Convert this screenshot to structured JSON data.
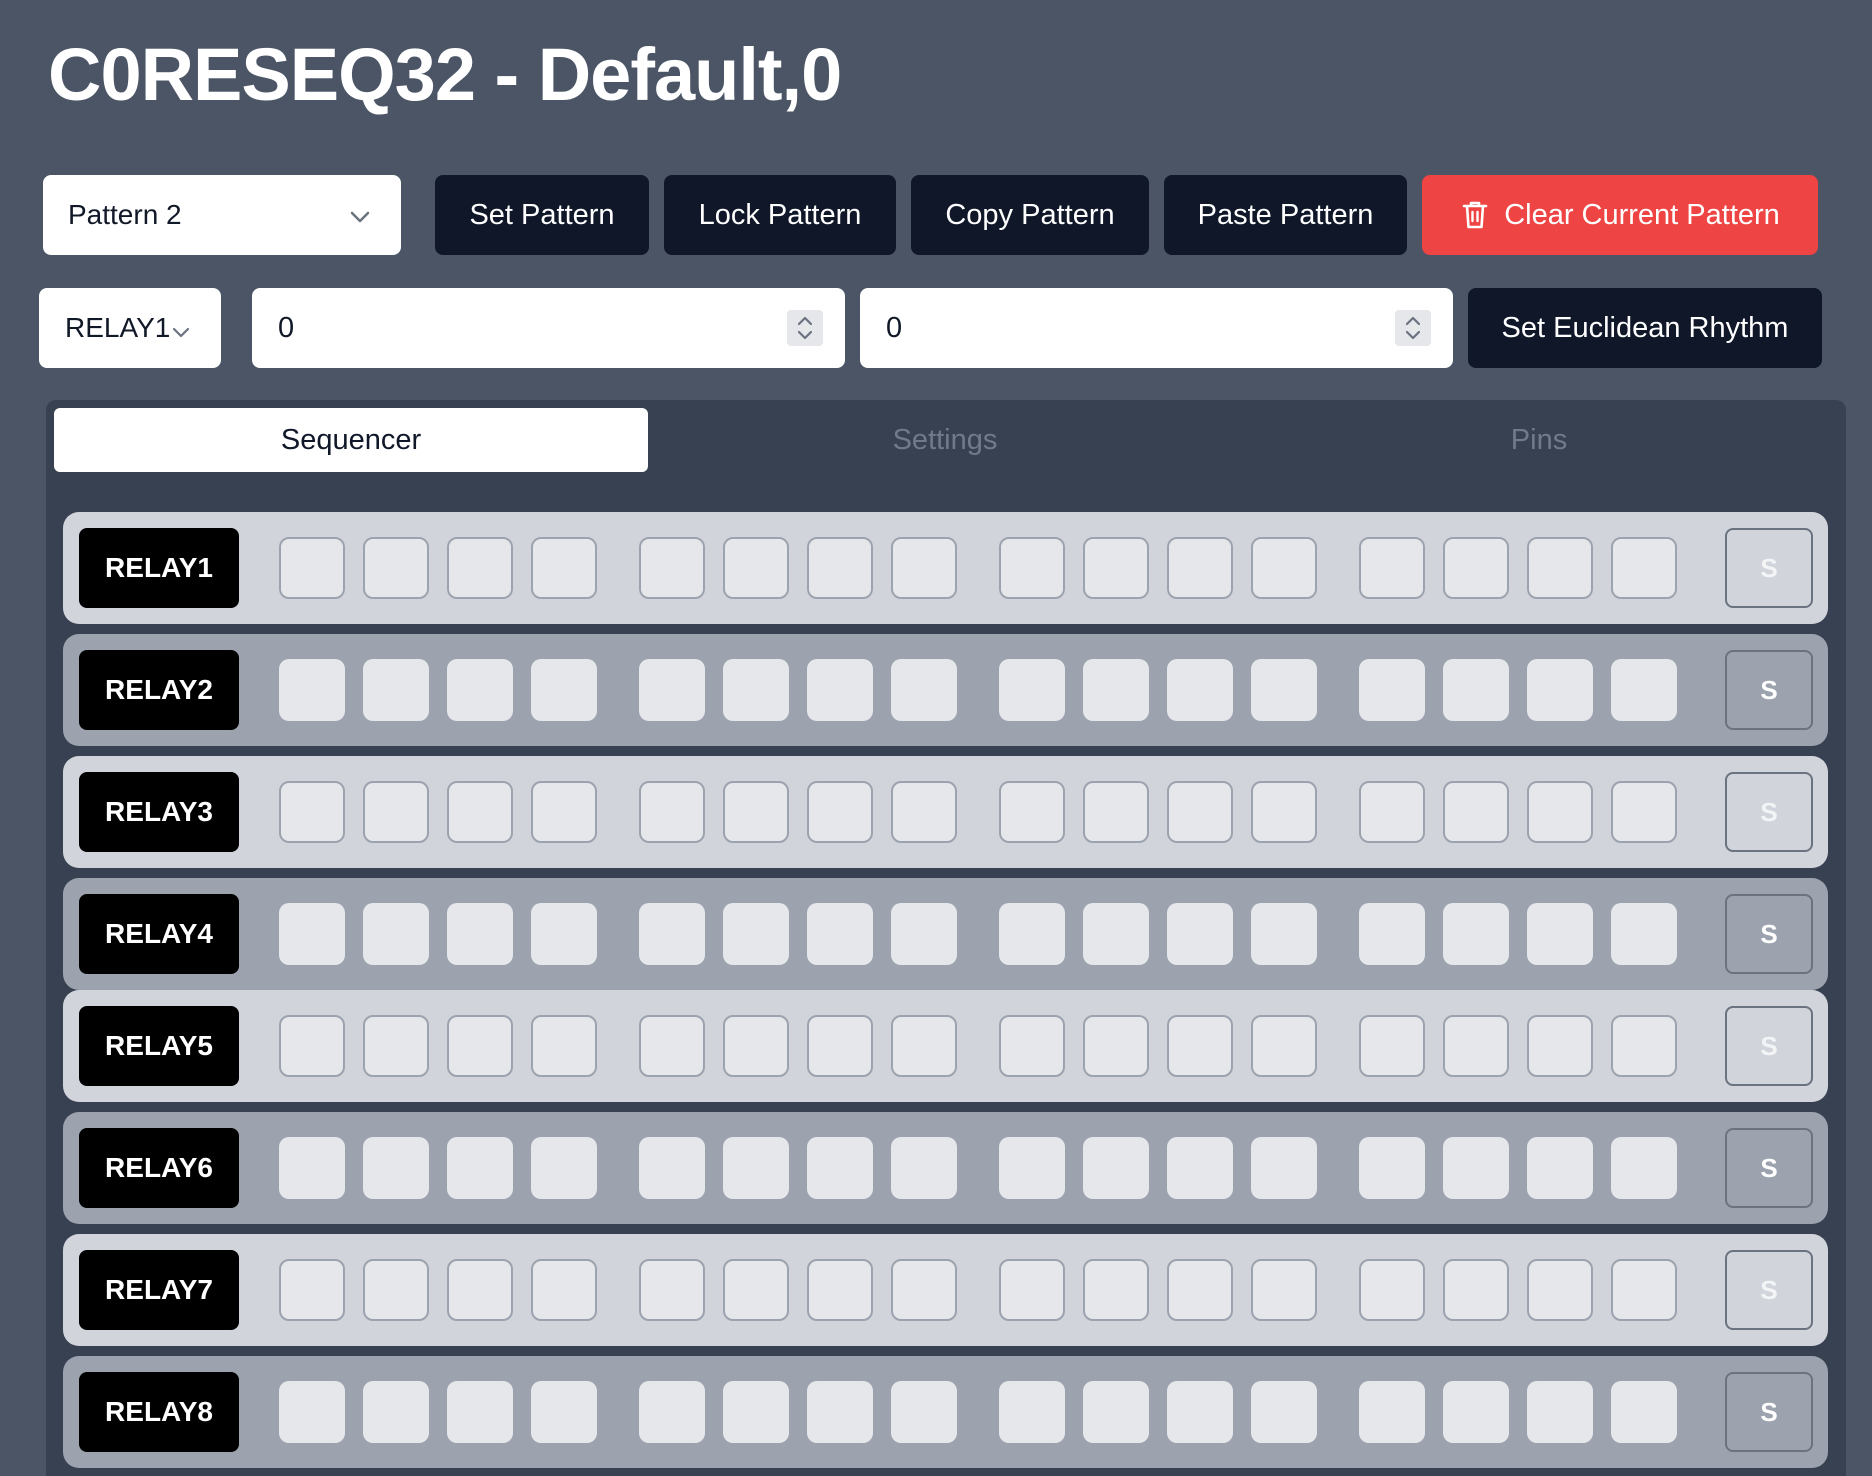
{
  "header": {
    "title": "C0RESEQ32 - Default,0"
  },
  "toolbar": {
    "pattern_select": {
      "value": "Pattern 2"
    },
    "set_pattern_label": "Set Pattern",
    "lock_pattern_label": "Lock Pattern",
    "copy_pattern_label": "Copy Pattern",
    "paste_pattern_label": "Paste Pattern",
    "clear_pattern_label": "Clear Current Pattern"
  },
  "euclid": {
    "relay_select": {
      "value": "RELAY1"
    },
    "steps_value": "0",
    "pulses_value": "0",
    "set_label": "Set Euclidean Rhythm"
  },
  "tabs": [
    {
      "label": "Sequencer",
      "active": true
    },
    {
      "label": "Settings",
      "active": false
    },
    {
      "label": "Pins",
      "active": false
    }
  ],
  "sequencer": {
    "steps_per_row": 16,
    "solo_label": "S",
    "rows": [
      {
        "label": "RELAY1"
      },
      {
        "label": "RELAY2"
      },
      {
        "label": "RELAY3"
      },
      {
        "label": "RELAY4"
      },
      {
        "label": "RELAY5"
      },
      {
        "label": "RELAY6"
      },
      {
        "label": "RELAY7"
      },
      {
        "label": "RELAY8"
      }
    ]
  },
  "colors": {
    "background": "#4b5566",
    "panel": "#384152",
    "button_dark": "#0f1729",
    "danger": "#ef4444"
  }
}
